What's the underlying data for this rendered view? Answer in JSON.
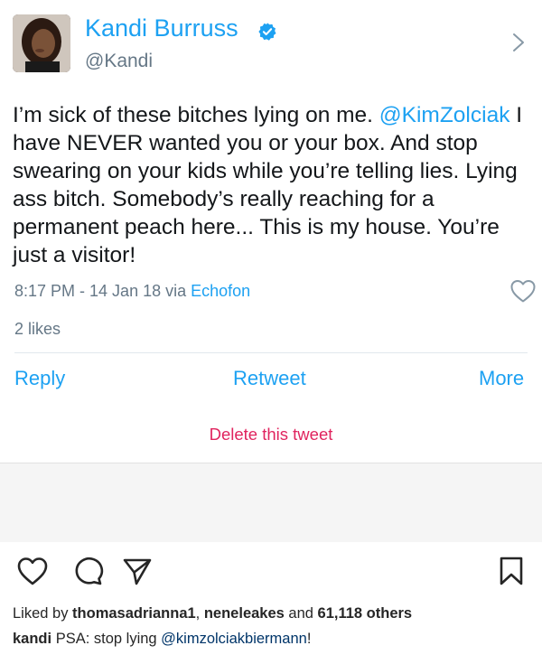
{
  "tweet": {
    "author": {
      "display_name": "Kandi Burruss",
      "handle": "@Kandi",
      "verified": true
    },
    "text_before_mention": "I’m sick of these bitches lying on me. ",
    "mention": "@KimZolciak",
    "text_after_mention": " I have NEVER wanted you or your box. And stop swearing on your kids while you’re telling lies. Lying ass bitch. Somebody’s really reaching for a permanent peach here... This is my house. You’re just a visitor!",
    "timestamp": "8:17 PM - 14 Jan 18 via ",
    "client": "Echofon",
    "likes": "2 likes",
    "actions": {
      "reply": "Reply",
      "retweet": "Retweet",
      "more": "More"
    },
    "delete_label": "Delete this tweet"
  },
  "instagram": {
    "liked_prefix": "Liked by ",
    "liked_user1": "thomasadrianna1",
    "liked_sep": ", ",
    "liked_user2": "neneleakes",
    "liked_and": " and ",
    "liked_others": "61,118 others",
    "caption_user": "kandi",
    "caption_text": " PSA: stop lying ",
    "caption_mention": "@kimzolciakbiermann",
    "caption_end": "!"
  },
  "colors": {
    "twitter_blue": "#1da1f2",
    "delete_red": "#e0245e",
    "meta_gray": "#657786",
    "ig_link": "#003569"
  },
  "icons": [
    "verified-badge-icon",
    "chevron-right-icon",
    "heart-outline-icon",
    "comment-icon",
    "share-paper-plane-icon",
    "bookmark-icon"
  ]
}
